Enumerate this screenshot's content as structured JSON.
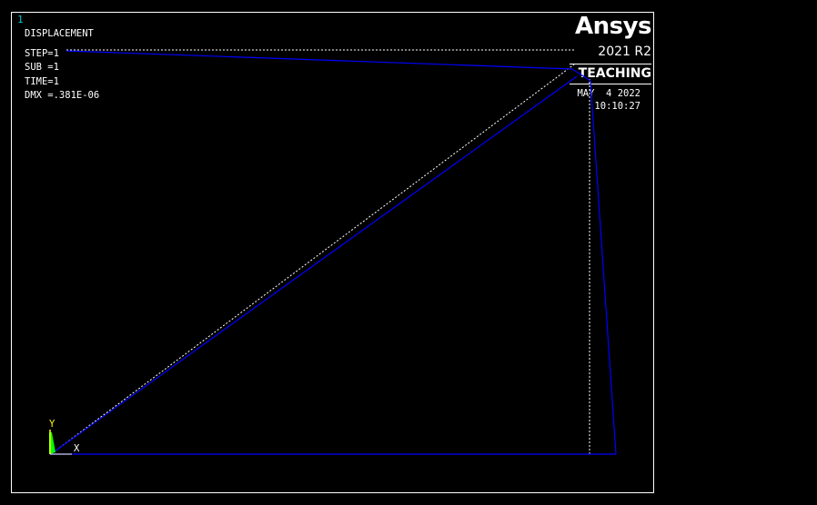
{
  "window": {
    "number": "1"
  },
  "plot_info": {
    "title": "DISPLACEMENT",
    "step": "STEP=1",
    "sub": "SUB =1",
    "time": "TIME=1",
    "dmx": "DMX =.381E-06"
  },
  "brand": {
    "name": "Ansys",
    "version": "2021 R2",
    "edition": "TEACHING"
  },
  "timestamp": {
    "date": "MAY  4 2022",
    "time": "10:10:27"
  },
  "triad": {
    "y_label": "Y",
    "x_label": "X"
  },
  "colors": {
    "background": "#000000",
    "deformed_shape": "#0000ff",
    "undeformed_shape": "#ffffff",
    "triad_x": "#ffffff",
    "triad_y": "#ffff00",
    "triad_z": "#00ff00",
    "window_number": "#00c8c8"
  }
}
